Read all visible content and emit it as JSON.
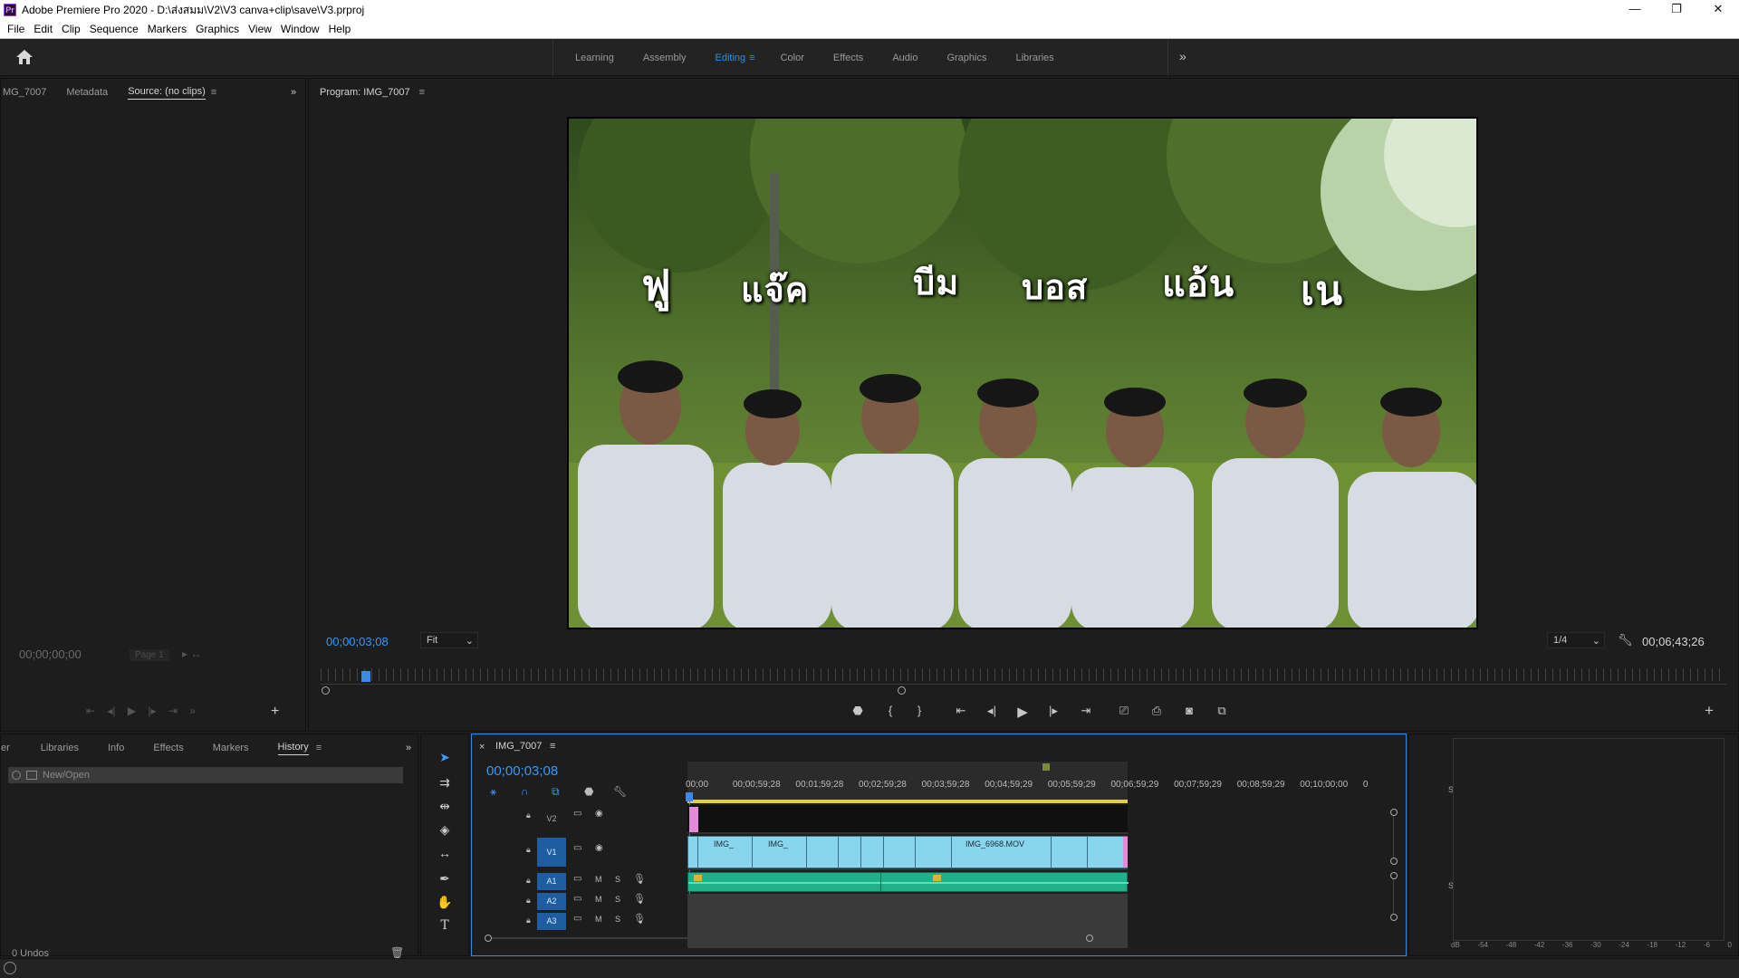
{
  "app": {
    "title": "Adobe Premiere Pro 2020 - D:\\ส่งสมม\\V2\\V3 canva+clip\\save\\V3.prproj",
    "logo_text": "Pr",
    "window_buttons": [
      "—",
      "❐",
      "✕"
    ]
  },
  "menu": [
    "File",
    "Edit",
    "Clip",
    "Sequence",
    "Markers",
    "Graphics",
    "View",
    "Window",
    "Help"
  ],
  "workspaces": {
    "tabs": [
      "Learning",
      "Assembly",
      "Editing",
      "Color",
      "Effects",
      "Audio",
      "Graphics",
      "Libraries"
    ],
    "active": "Editing",
    "more": "»"
  },
  "source_panel": {
    "tabs": [
      "MG_7007",
      "Metadata",
      "Source: (no clips)"
    ],
    "active": "Source: (no clips)",
    "menu_icon": "≡",
    "expand": "»",
    "timecode": "00;00;00;00",
    "page_label": "Page 1"
  },
  "program_panel": {
    "title": "Program: IMG_7007",
    "menu_icon": "≡",
    "timecode": "00;00;03;08",
    "fit": "Fit",
    "resolution": "1/4",
    "duration": "00;06;43;26",
    "names_overlay": [
      "ฟู",
      "แจ๊ค",
      "บีม",
      "บอส",
      "แอ้น",
      "เน"
    ]
  },
  "bottom_left_panel": {
    "tabs": [
      "er",
      "Libraries",
      "Info",
      "Effects",
      "Markers",
      "History"
    ],
    "active": "History",
    "menu_icon": "≡",
    "expand": "»",
    "history_items": [
      "New/Open"
    ],
    "undos": "0 Undos"
  },
  "timeline": {
    "sequence_name": "IMG_7007",
    "close": "×",
    "menu_icon": "≡",
    "timecode": "00;00;03;08",
    "ruler": [
      "00;00",
      "00;00;59;28",
      "00;01;59;28",
      "00;02;59;28",
      "00;03;59;28",
      "00;04;59;29",
      "00;05;59;29",
      "00;06;59;29",
      "00;07;59;29",
      "00;08;59;29",
      "00;10;00;00",
      "0"
    ],
    "tracks": {
      "video": [
        {
          "name": "V2"
        },
        {
          "name": "V1"
        }
      ],
      "audio": [
        {
          "name": "A1",
          "m": "M",
          "s": "S"
        },
        {
          "name": "A2",
          "m": "M",
          "s": "S"
        },
        {
          "name": "A3",
          "m": "M",
          "s": "S"
        }
      ]
    },
    "clip_labels": [
      "IMG_",
      "IMG_",
      "IMG_6968.MOV"
    ]
  },
  "audio_meter": {
    "solo": [
      "S",
      "S"
    ],
    "scale": [
      "dB",
      "-54",
      "-48",
      "-42",
      "-36",
      "-30",
      "-24",
      "-18",
      "-12",
      "-6",
      "0"
    ]
  },
  "colors": {
    "accent": "#2d8ceb",
    "video_clip": "#8ad5ee",
    "audio_clip": "#1fb28a",
    "bg": "#1d1d1d"
  }
}
